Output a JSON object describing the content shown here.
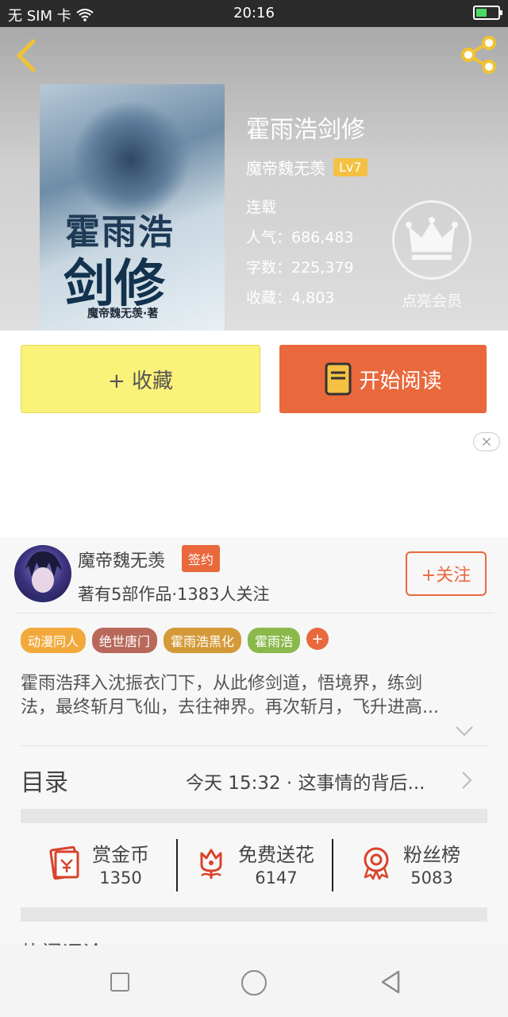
{
  "status_bar": {
    "carrier": "无 SIM 卡",
    "time": "20:16",
    "battery_level": 0.5
  },
  "book": {
    "title": "霍雨浩剑修",
    "author": "魔帝魏无羡",
    "level": "Lv7",
    "status": "连载",
    "popularity": "人气：686,483",
    "word_count": "字数：225,379",
    "favorites": "收藏：4,803",
    "cover_title_line1": "霍雨浩",
    "cover_title_line2": "剑修",
    "cover_author": "魔帝魏无羡·著"
  },
  "vip": {
    "label": "点亮会员"
  },
  "actions": {
    "collect_label": "+ 收藏",
    "read_label": "开始阅读"
  },
  "author_card": {
    "name": "魔帝魏无羡",
    "badge": "签约",
    "info": "著有5部作品·1383人关注",
    "follow_label": "+关注"
  },
  "tags": [
    {
      "label": "动漫同人",
      "color": "#f2a93b"
    },
    {
      "label": "绝世唐门",
      "color": "#b8695b"
    },
    {
      "label": "霍雨浩黑化",
      "color": "#d49a3a"
    },
    {
      "label": "霍雨浩",
      "color": "#8bb84a"
    }
  ],
  "tag_more": "+",
  "synopsis": {
    "line1": "霍雨浩拜入沈振衣门下，从此修剑道，悟境界，练剑",
    "line2": "法，最终斩月飞仙，去往神界。再次斩月，飞升进高..."
  },
  "toc": {
    "label": "目录",
    "latest": "今天 15:32 · 这事情的背后..."
  },
  "stats": [
    {
      "label": "赏金币",
      "value": "1350",
      "icon": "red-envelope-icon"
    },
    {
      "label": "免费送花",
      "value": "6147",
      "icon": "flower-icon"
    },
    {
      "label": "粉丝榜",
      "value": "5083",
      "icon": "medal-icon"
    }
  ],
  "hot_comments_peek": "热门评论",
  "accent_color": "#e9683c"
}
